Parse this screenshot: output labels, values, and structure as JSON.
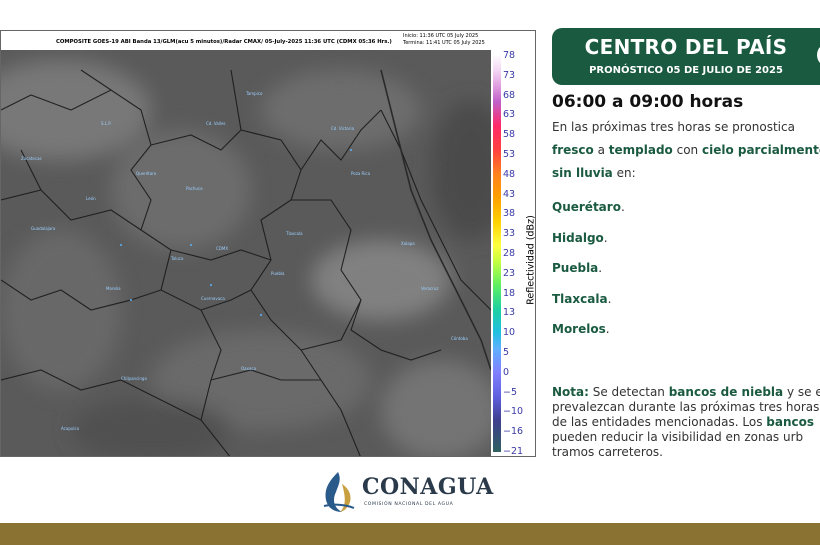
{
  "map": {
    "caption": "COMPOSITE GOES-19 ABI Banda 13/GLM(acu 5 minutos)/Radar CMAX/ 05-July-2025 11:36 UTC  (CDMX  05:36 Hrs.)",
    "init_time": "Inicio: 11:36 UTC 05 July 2025",
    "end_time": "Termina: 11:41 UTC 05 July 2025",
    "scale_label": "Reflectividad (dBz)",
    "scale_ticks": [
      "78",
      "73",
      "68",
      "63",
      "58",
      "53",
      "48",
      "43",
      "38",
      "33",
      "28",
      "23",
      "18",
      "13",
      "10",
      "5",
      "0",
      "−5",
      "−10",
      "−16",
      "−21"
    ]
  },
  "banner": {
    "title": "CENTRO DEL PAÍS",
    "subtitle": "PRONÓSTICO 05 DE JULIO DE 2025"
  },
  "forecast": {
    "time_range": "06:00 a 09:00 horas",
    "line1": "En las próximas tres horas se pronostica",
    "line2_a": "fresco",
    "line2_b": " a ",
    "line2_c": "templado",
    "line2_d": " con ",
    "line2_e": "cielo parcialmente",
    "line3_a": "sin lluvia",
    "line3_b": " en:",
    "states": [
      "Querétaro",
      "Hidalgo",
      "Puebla",
      "Tlaxcala",
      "Morelos"
    ],
    "state_suffix": "."
  },
  "note": {
    "label": "Nota:",
    "l1_a": " Se detectan ",
    "l1_b": "bancos de niebla",
    "l1_c": " y se e",
    "l2": "prevalezcan durante las próximas tres horas",
    "l3_a": "de las entidades mencionadas. Los ",
    "l3_b": "bancos",
    "l4": "pueden reducir la visibilidad en zonas urb",
    "l5": "tramos carreteros."
  },
  "footer": {
    "logo_name": "CONAGUA",
    "logo_subtitle": "COMISIÓN NACIONAL DEL AGUA",
    "logo_icon": "conagua-logo-icon",
    "bar_color": "#8a7232"
  },
  "colors": {
    "brand_green": "#1a5a40",
    "scale_text": "#3a3aa8"
  }
}
